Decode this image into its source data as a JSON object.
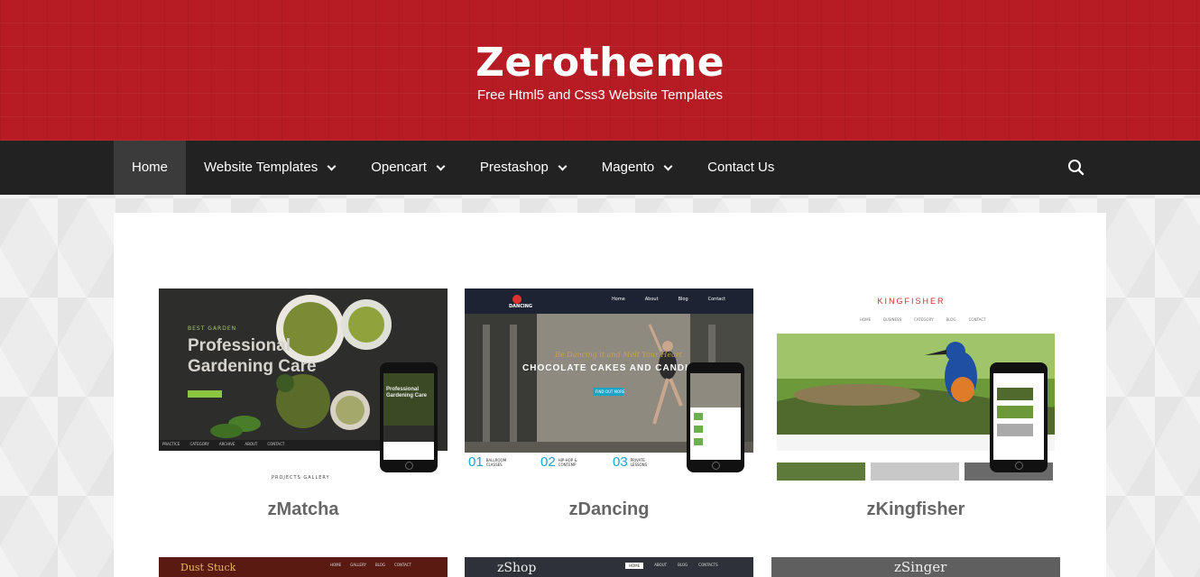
{
  "header": {
    "title": "Zerotheme",
    "tagline": "Free Html5 and Css3 Website Templates"
  },
  "nav": {
    "items": [
      {
        "label": "Home",
        "active": true,
        "dropdown": false
      },
      {
        "label": "Website Templates",
        "active": false,
        "dropdown": true
      },
      {
        "label": "Opencart",
        "active": false,
        "dropdown": true
      },
      {
        "label": "Prestashop",
        "active": false,
        "dropdown": true
      },
      {
        "label": "Magento",
        "active": false,
        "dropdown": true
      },
      {
        "label": "Contact Us",
        "active": false,
        "dropdown": false
      }
    ],
    "search_icon": "search-icon"
  },
  "colors": {
    "header_red": "#b71c24",
    "nav_dark": "#222222",
    "nav_active": "#3b3b3b",
    "card_title": "#666666"
  },
  "cards": [
    {
      "title": "zMatcha",
      "thumb": {
        "kicker": "BEST GARDEN",
        "headline_1": "Professional",
        "headline_2": "Gardening Care",
        "menu": [
          "PRACTICE",
          "CATEGORY",
          "ARCHIVE",
          "ABOUT",
          "CONTACT"
        ],
        "footer": "PROJECTS GALLERY",
        "phone_text": "Professional Gardening Care"
      }
    },
    {
      "title": "zDancing",
      "thumb": {
        "logo": "DANCING",
        "menu": [
          "Home",
          "About",
          "Blog",
          "Contact"
        ],
        "script_line": "Be Dancing it and Melt Your Heart",
        "headline": "CHOCOLATE CAKES AND CANDIES",
        "cta": "FIND OUT MORE",
        "features": [
          {
            "num": "01",
            "label": "BALLROOM CLASSES"
          },
          {
            "num": "02",
            "label": "HIP-HOP & CONTEMP"
          },
          {
            "num": "03",
            "label": "PRIVATE LESSONS"
          }
        ]
      }
    },
    {
      "title": "zKingfisher",
      "thumb": {
        "logo": "KINGFISHER",
        "menu": [
          "HOME",
          "BUSINESS",
          "CATEGORY",
          "BLOG",
          "CONTACT"
        ]
      }
    }
  ],
  "next_row": [
    {
      "label": "Dust Stuck"
    },
    {
      "label": "zShop",
      "menu": [
        "HOME",
        "ABOUT",
        "BLOG",
        "CONTACTS"
      ]
    },
    {
      "label": "zSinger"
    }
  ]
}
